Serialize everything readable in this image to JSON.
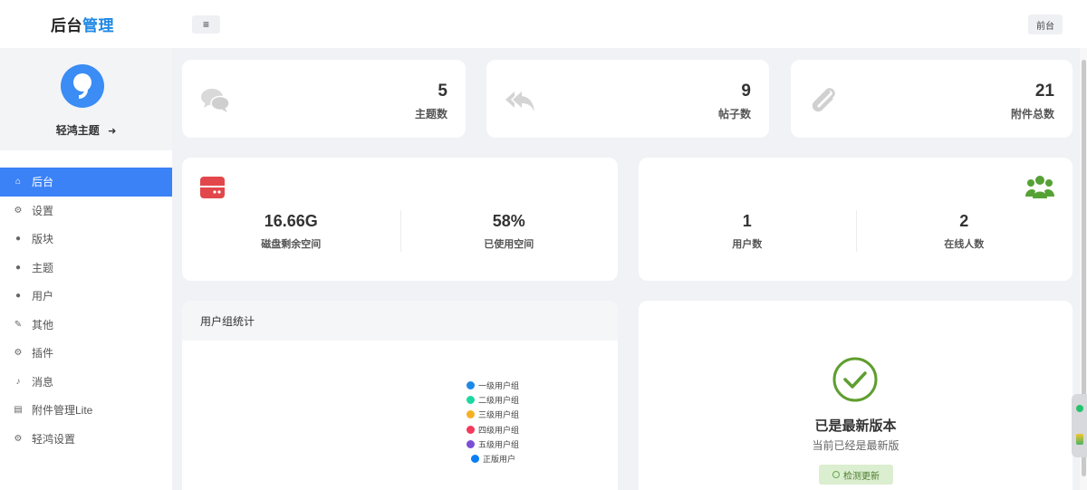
{
  "brand": {
    "part1": "后台",
    "part2": "管理"
  },
  "header": {
    "menu_icon": "≡",
    "front_label": "前台"
  },
  "profile": {
    "name": "轻鸿主题",
    "logout_icon": "➜"
  },
  "nav": [
    {
      "label": "后台",
      "icon": "⌂",
      "active": true
    },
    {
      "label": "设置",
      "icon": "⚙"
    },
    {
      "label": "版块",
      "icon": "●"
    },
    {
      "label": "主题",
      "icon": "●"
    },
    {
      "label": "用户",
      "icon": "●"
    },
    {
      "label": "其他",
      "icon": "✎"
    },
    {
      "label": "插件",
      "icon": "⚙"
    },
    {
      "label": "消息",
      "icon": "♪"
    },
    {
      "label": "附件管理Lite",
      "icon": "▤"
    },
    {
      "label": "轻鸿设置",
      "icon": "⚙"
    }
  ],
  "stats": {
    "topics": {
      "value": "5",
      "label": "主题数"
    },
    "posts": {
      "value": "9",
      "label": "帖子数"
    },
    "attachments": {
      "value": "21",
      "label": "附件总数"
    }
  },
  "disk": {
    "free": {
      "value": "16.66G",
      "label": "磁盘剩余空间"
    },
    "used": {
      "value": "58%",
      "label": "已使用空间"
    }
  },
  "users": {
    "count": {
      "value": "1",
      "label": "用户数"
    },
    "online": {
      "value": "2",
      "label": "在线人数"
    }
  },
  "group_stats": {
    "title": "用户组统计",
    "legend": [
      {
        "label": "一级用户组",
        "color": "#1e88e5"
      },
      {
        "label": "二级用户组",
        "color": "#1dd8a0"
      },
      {
        "label": "三级用户组",
        "color": "#f5b025"
      },
      {
        "label": "四级用户组",
        "color": "#f23a5a"
      },
      {
        "label": "五级用户组",
        "color": "#7a4fd6"
      },
      {
        "label": "正版用户",
        "color": "#0a7ff5"
      }
    ]
  },
  "version": {
    "title": "已是最新版本",
    "subtitle": "当前已经是最新版",
    "check_label": "检测更新"
  }
}
